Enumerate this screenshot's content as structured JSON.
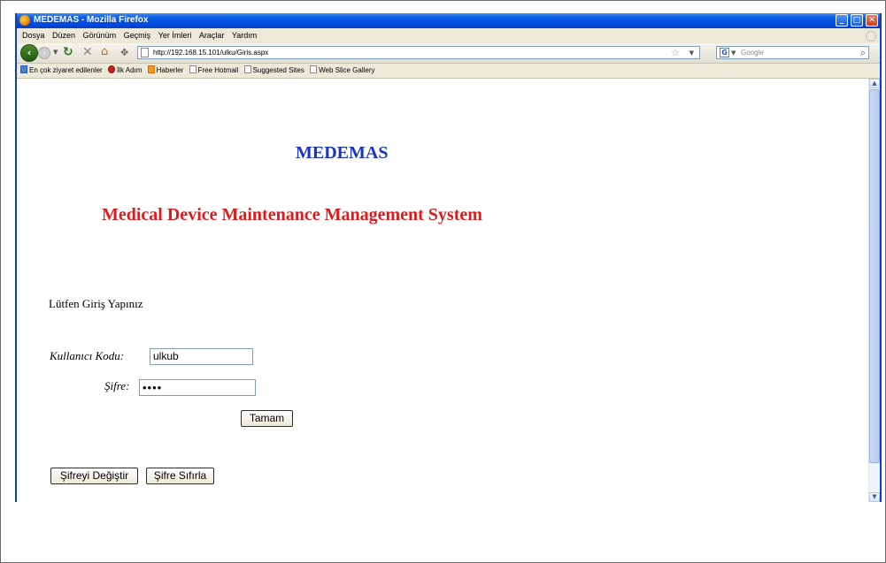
{
  "window": {
    "title": "MEDEMAS - Mozilla Firefox",
    "buttons": {
      "minimize": "_",
      "maximize": "□",
      "close": "✕"
    }
  },
  "menu": [
    "Dosya",
    "Düzen",
    "Görünüm",
    "Geçmiş",
    "Yer İmleri",
    "Araçlar",
    "Yardım"
  ],
  "navigation": {
    "url": "http://192.168.15.101/ulku/Giris.aspx",
    "search_placeholder": "Google",
    "icons": [
      "back-icon",
      "forward-icon",
      "reload-icon",
      "stop-icon",
      "home-icon",
      "identity-icon",
      "bookmark-star-icon",
      "search-icon"
    ]
  },
  "bookmarks": [
    {
      "label": "En çok ziyaret edilenler",
      "icon": "blue"
    },
    {
      "label": "İlk Adım",
      "icon": "red"
    },
    {
      "label": "Haberler",
      "icon": "rss"
    },
    {
      "label": "Free Hotmail",
      "icon": "page"
    },
    {
      "label": "Suggested Sites",
      "icon": "page"
    },
    {
      "label": "Web Slice Gallery",
      "icon": "page"
    }
  ],
  "page": {
    "title": "MEDEMAS",
    "subtitle": "Medical Device Maintenance Management System",
    "prompt": "Lütfen  Giriş Yapınız",
    "username_label": "Kullanıcı Kodu:",
    "username_value": "ulkub",
    "password_label": "Şifre:",
    "password_value": "••••",
    "submit_label": "Tamam",
    "change_password_label": "Şifreyi Değiştir",
    "reset_password_label": "Şifre Sıfırla"
  },
  "colors": {
    "title_color": "#1a34c4",
    "subtitle_color": "#e01a1a",
    "titlebar_blue": "#0048dd"
  }
}
